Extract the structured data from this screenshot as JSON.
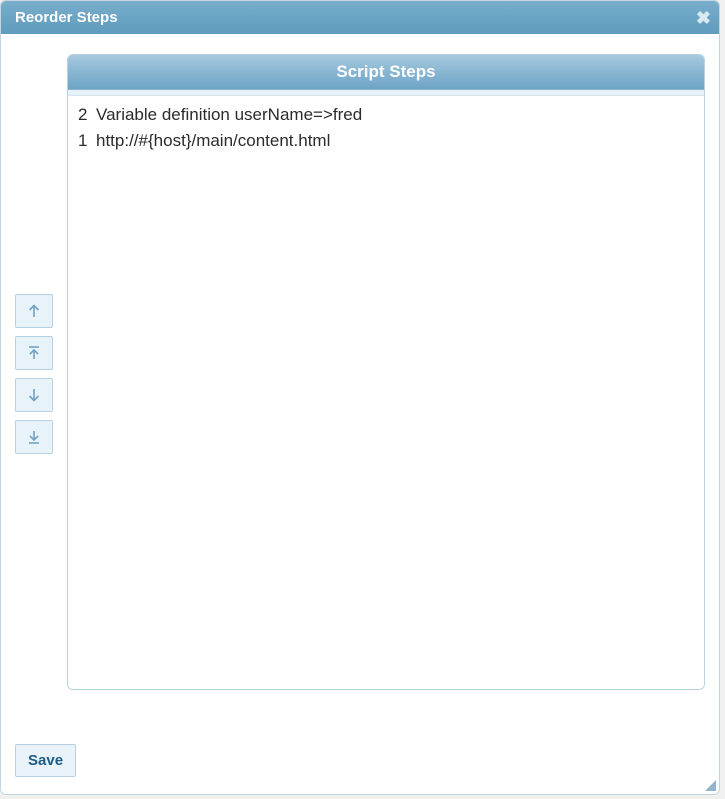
{
  "dialog": {
    "title": "Reorder Steps"
  },
  "panel": {
    "title": "Script Steps"
  },
  "steps": [
    {
      "order": "2",
      "description": "Variable definition userName=>fred"
    },
    {
      "order": "1",
      "description": "http://#{host}/main/content.html"
    }
  ],
  "buttons": {
    "save": "Save"
  },
  "icons": {
    "up": "arrow-up",
    "top": "arrow-to-top",
    "down": "arrow-down",
    "bottom": "arrow-to-bottom",
    "close": "✖"
  }
}
